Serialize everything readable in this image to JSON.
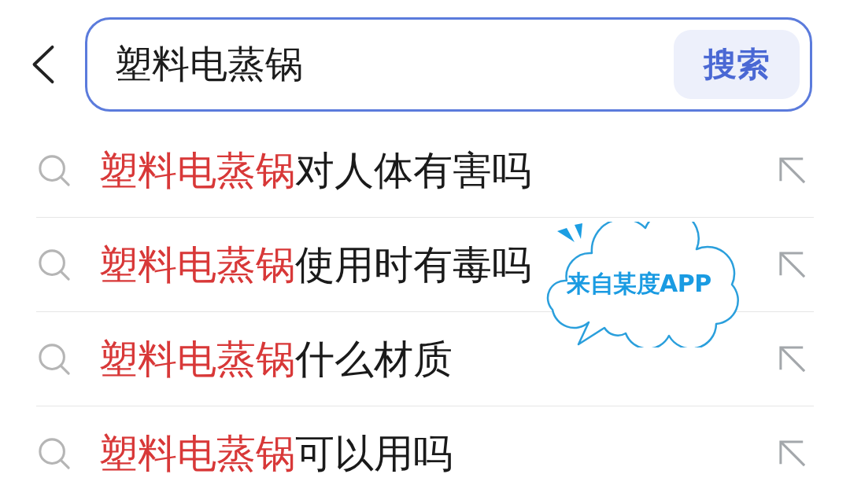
{
  "search_bar": {
    "value": "塑料电蒸锅",
    "button": "搜索"
  },
  "suggestions": [
    {
      "match": "塑料电蒸锅",
      "rest": "对人体有害吗"
    },
    {
      "match": "塑料电蒸锅",
      "rest": "使用时有毒吗"
    },
    {
      "match": "塑料电蒸锅",
      "rest": "什么材质"
    },
    {
      "match": "塑料电蒸锅",
      "rest": "可以用吗"
    }
  ],
  "callout": {
    "text": "来自某度APP"
  }
}
